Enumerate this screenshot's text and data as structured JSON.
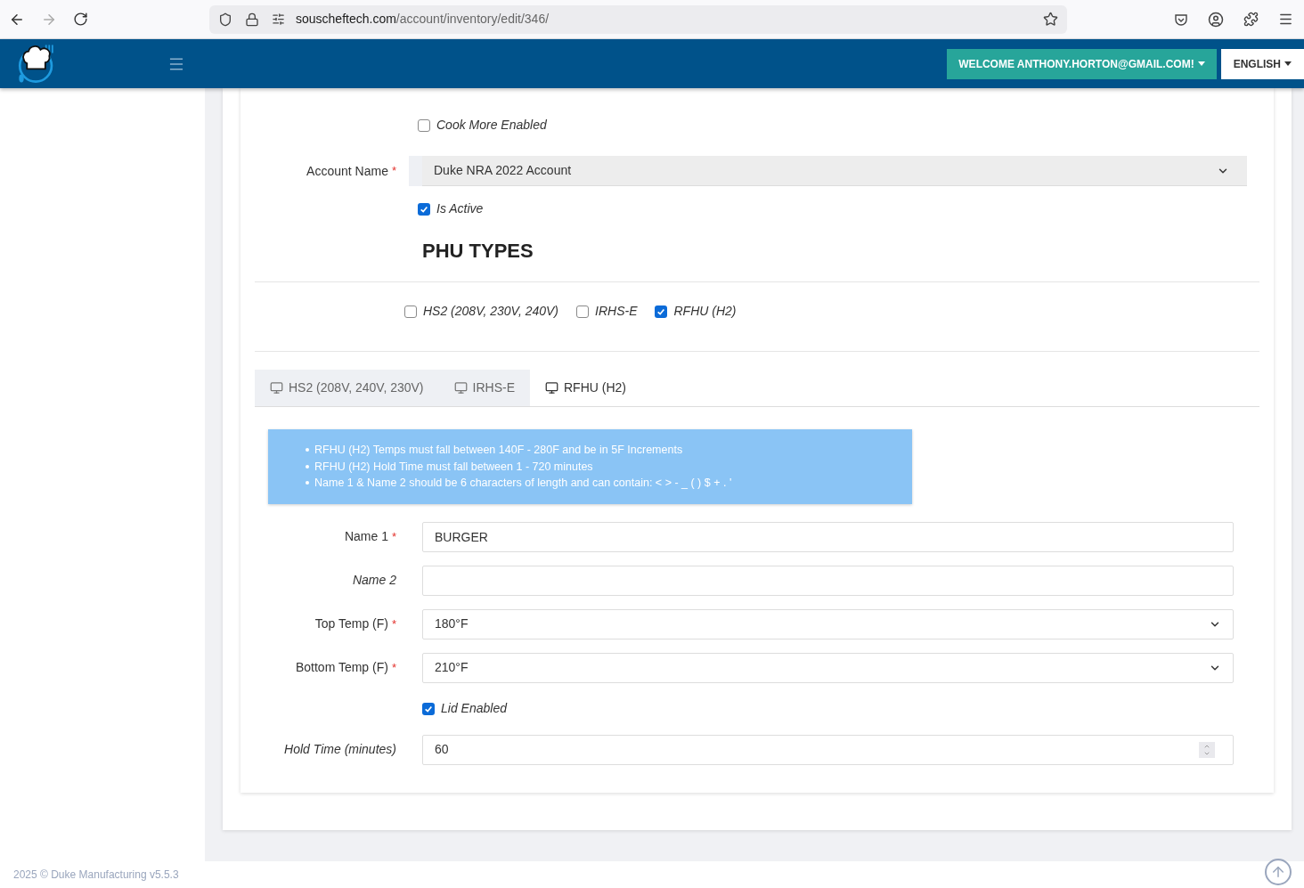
{
  "browser": {
    "url_host": "souscheftech.com",
    "url_path": "/account/inventory/edit/346/"
  },
  "header": {
    "welcome": "WELCOME ANTHONY.HORTON@GMAIL.COM!",
    "language": "ENGLISH"
  },
  "cook_more_enabled": {
    "label": "Cook More Enabled",
    "checked": false
  },
  "account": {
    "label": "Account Name",
    "required_mark": "*",
    "value": "Duke NRA 2022 Account"
  },
  "is_active": {
    "label": "Is Active",
    "checked": true
  },
  "phu_title": "PHU TYPES",
  "phu_types": [
    {
      "label": "HS2 (208V, 230V, 240V)",
      "checked": false
    },
    {
      "label": "IRHS-E",
      "checked": false
    },
    {
      "label": "RFHU (H2)",
      "checked": true
    }
  ],
  "tabs": [
    {
      "label": "HS2 (208V, 240V, 230V)",
      "selected": false
    },
    {
      "label": "IRHS-E",
      "selected": false
    },
    {
      "label": "RFHU (H2)",
      "selected": true
    }
  ],
  "notes": [
    "RFHU (H2) Temps must fall between 140F - 280F and be in 5F Increments",
    "RFHU (H2) Hold Time must fall between 1 - 720 minutes",
    "Name 1 & Name 2 should be 6 characters of length and can contain: < > - _ ( ) $ + . '"
  ],
  "fields": [
    {
      "kind": "text",
      "label": "Name 1",
      "required_mark": "*",
      "value": "BURGER"
    },
    {
      "kind": "text",
      "label": "Name 2"
    },
    {
      "kind": "select",
      "label": "Top Temp (F)",
      "required_mark": "*",
      "value": "180°F"
    },
    {
      "kind": "select",
      "label": "Bottom Temp (F)",
      "required_mark": "*",
      "value": "210°F"
    },
    {
      "kind": "checkbox",
      "label": "Lid Enabled",
      "checked": true
    },
    {
      "kind": "number",
      "label": "Hold Time (minutes)",
      "value": "60"
    }
  ],
  "footer": "2025 © Duke Manufacturing v5.5.3"
}
